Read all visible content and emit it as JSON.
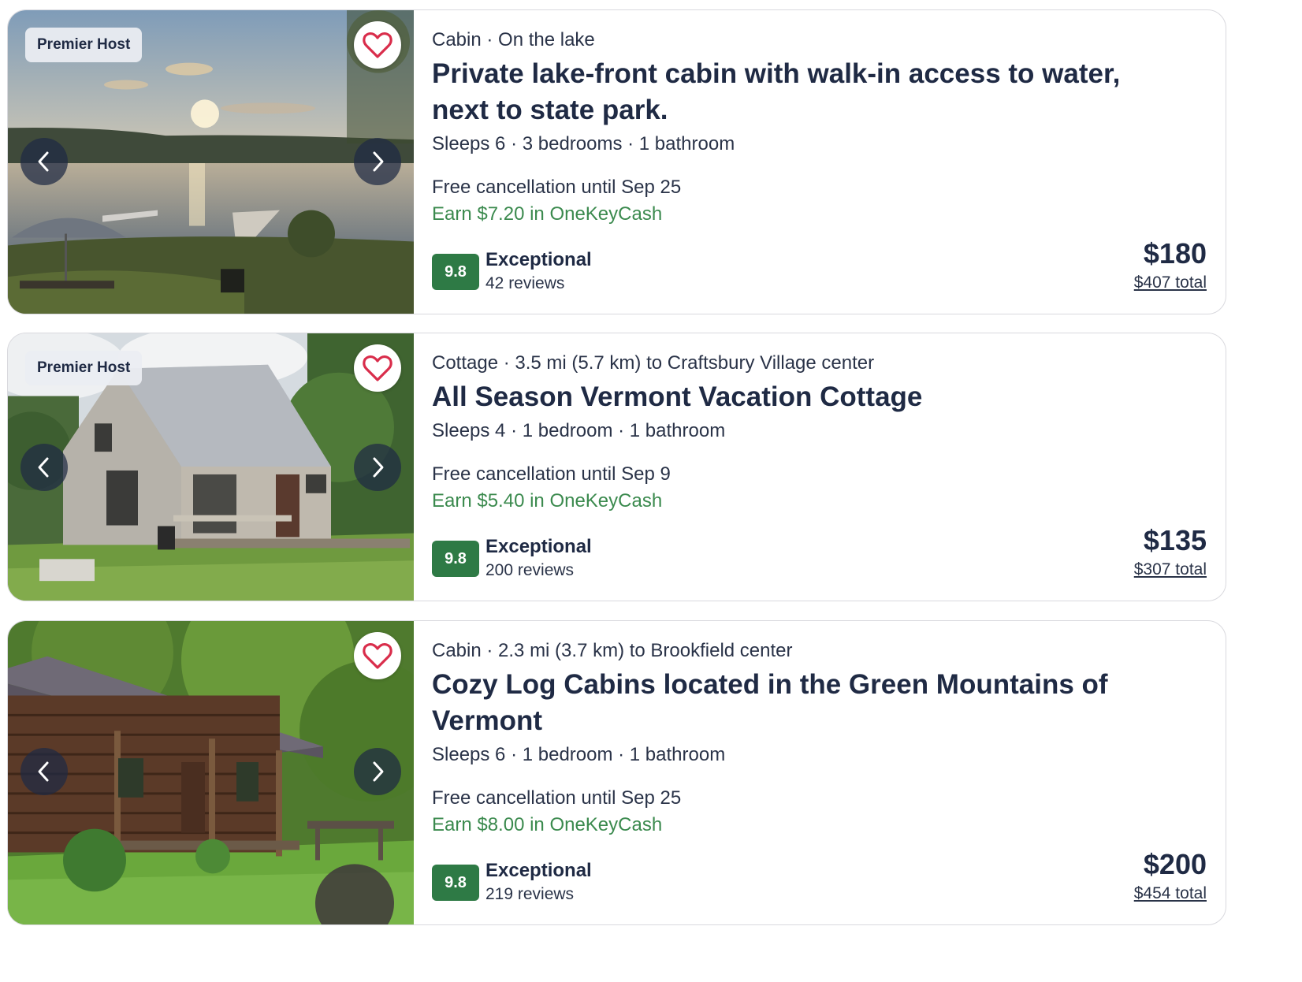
{
  "listings": [
    {
      "badge": "Premier Host",
      "meta": "Cabin · On the lake",
      "title": "Private lake-front cabin with walk-in access to water, next to state park.",
      "facts": "Sleeps 6 · 3 bedrooms · 1 bathroom",
      "cancellation": "Free cancellation until Sep 25",
      "cash": "Earn $7.20 in OneKeyCash",
      "score": "9.8",
      "rating_label": "Exceptional",
      "reviews": "42 reviews",
      "price": "$180",
      "total": "$407 total"
    },
    {
      "badge": "Premier Host",
      "meta": "Cottage · 3.5 mi (5.7 km) to Craftsbury Village center",
      "title": "All Season Vermont Vacation Cottage",
      "facts": "Sleeps 4 · 1 bedroom · 1 bathroom",
      "cancellation": "Free cancellation until Sep 9",
      "cash": "Earn $5.40 in OneKeyCash",
      "score": "9.8",
      "rating_label": "Exceptional",
      "reviews": "200 reviews",
      "price": "$135",
      "total": "$307 total"
    },
    {
      "meta": "Cabin · 2.3 mi (3.7 km) to Brookfield center",
      "title": "Cozy Log Cabins located in the Green Mountains of Vermont",
      "facts": "Sleeps 6 · 1 bedroom · 1 bathroom",
      "cancellation": "Free cancellation until Sep 25",
      "cash": "Earn $8.00 in OneKeyCash",
      "score": "9.8",
      "rating_label": "Exceptional",
      "reviews": "219 reviews",
      "price": "$200",
      "total": "$454 total"
    }
  ],
  "icons": {
    "favorite": "heart-icon",
    "previous": "chevron-left-icon",
    "next": "chevron-right-icon"
  },
  "colors": {
    "text": "#1f2a44",
    "rating_badge": "#2e7a45",
    "cash_text": "#3b8a4e",
    "heart": "#d92d4b"
  }
}
